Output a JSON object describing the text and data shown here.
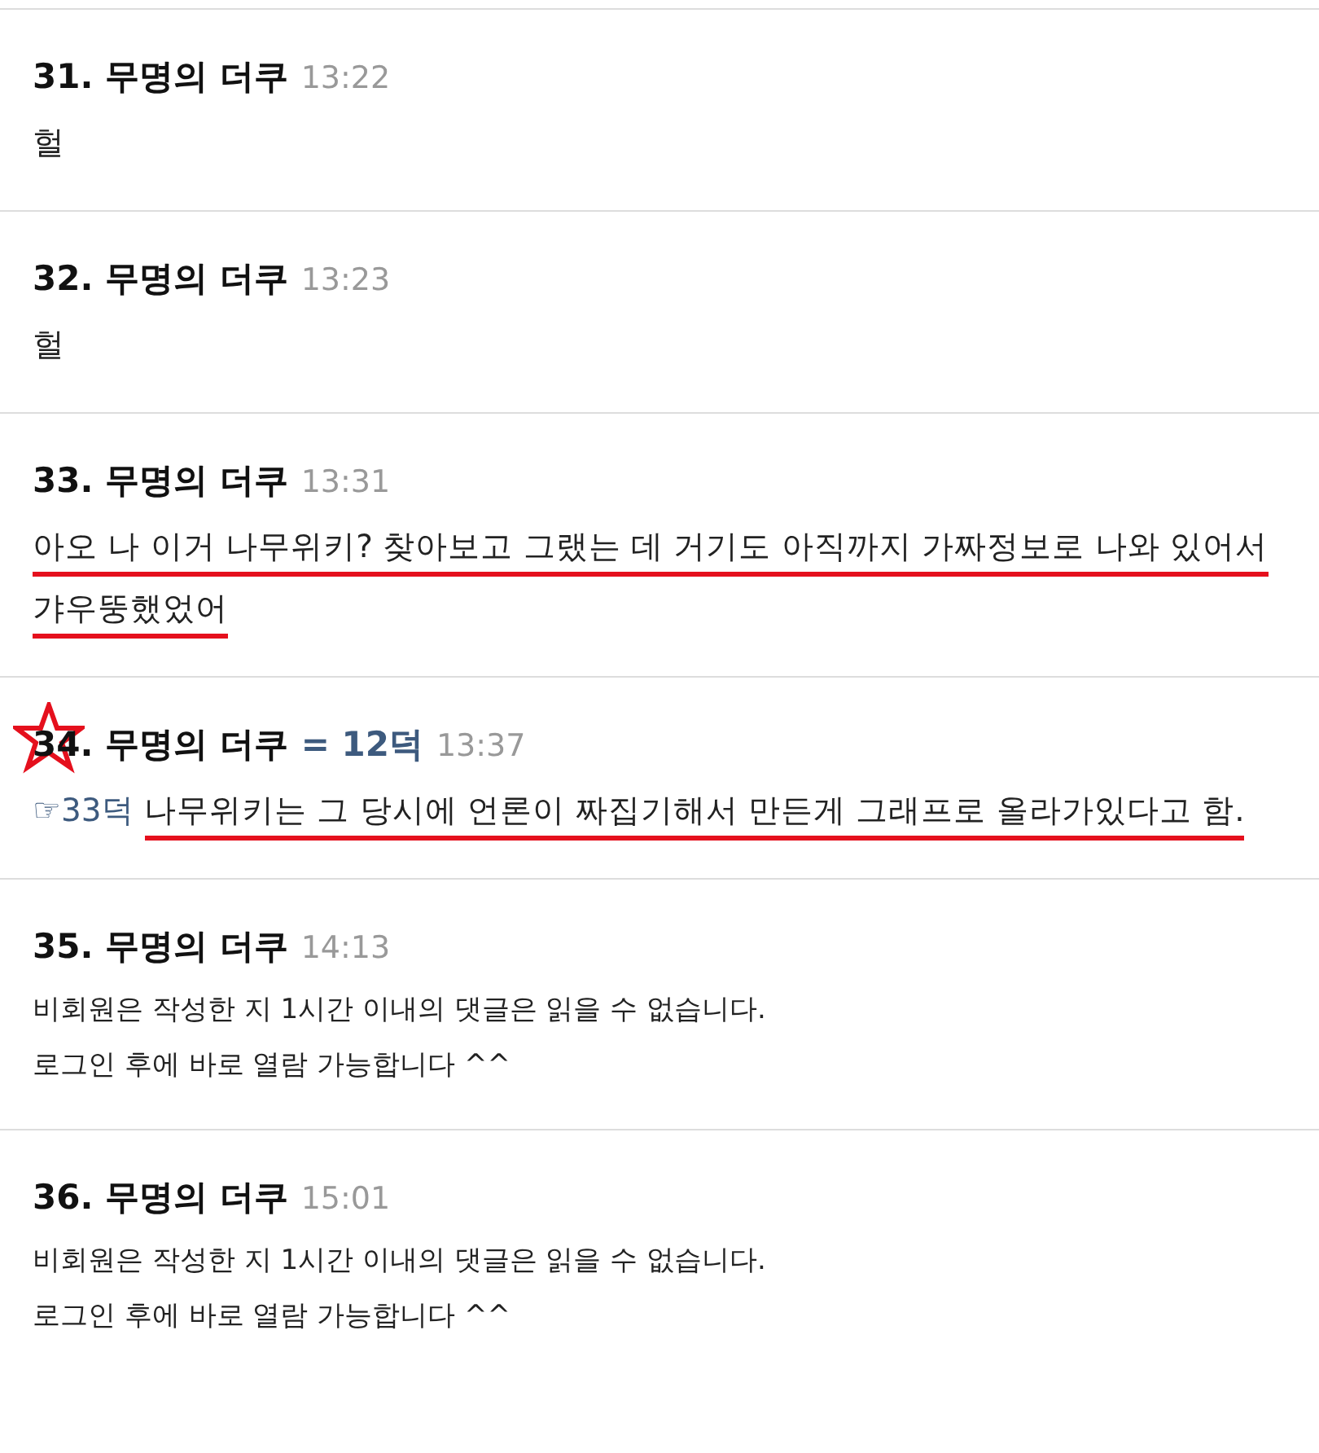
{
  "comments": [
    {
      "number": "31.",
      "author": "무명의 더쿠",
      "time": "13:22",
      "starred": false,
      "kind": "text",
      "underlined": false,
      "lines": [
        "헐"
      ]
    },
    {
      "number": "32.",
      "author": "무명의 더쿠",
      "time": "13:23",
      "starred": false,
      "kind": "text",
      "underlined": false,
      "lines": [
        "헐"
      ]
    },
    {
      "number": "33.",
      "author": "무명의 더쿠",
      "time": "13:31",
      "starred": false,
      "kind": "text",
      "underlined": true,
      "lines": [
        "아오 나 이거 나무위키? 찾아보고 그랬는 데 거기도 아직까지 가짜정보로 나와 있어서 갸우뚱했었어"
      ]
    },
    {
      "number": "34.",
      "author": "무명의 더쿠",
      "score": "= 12덕",
      "time": "13:37",
      "starred": true,
      "kind": "text",
      "underlined": true,
      "reply_to": "☞33덕",
      "lines": [
        "나무위키는 그 당시에 언론이 짜집기해서 만든게 그래프로 올라가있다고 함."
      ]
    },
    {
      "number": "35.",
      "author": "무명의 더쿠",
      "time": "14:13",
      "starred": false,
      "kind": "notice",
      "underlined": false,
      "lines": [
        "비회원은 작성한 지 1시간 이내의 댓글은 읽을 수 없습니다.",
        "로그인 후에 바로 열람 가능합니다 ^^"
      ]
    },
    {
      "number": "36.",
      "author": "무명의 더쿠",
      "time": "15:01",
      "starred": false,
      "kind": "notice",
      "underlined": false,
      "lines": [
        "비회원은 작성한 지 1시간 이내의 댓글은 읽을 수 없습니다.",
        "로그인 후에 바로 열람 가능합니다 ^^"
      ]
    }
  ]
}
